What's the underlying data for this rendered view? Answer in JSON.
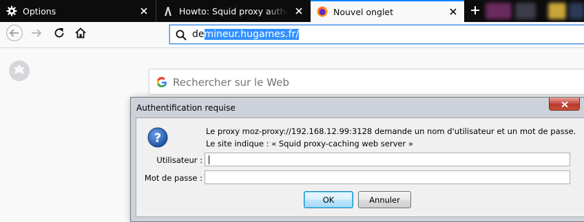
{
  "tabs": [
    {
      "label": "Options",
      "icon": "gear-icon",
      "active": false
    },
    {
      "label": "Howto: Squid proxy authentication",
      "icon": "site-favicon-icon",
      "active": false
    },
    {
      "label": "Nouvel onglet",
      "icon": "firefox-icon",
      "active": true
    }
  ],
  "address_bar": {
    "text_unselected": "de",
    "text_selected": "mineur.hugames.fr/"
  },
  "search_box": {
    "placeholder": "Rechercher sur le Web"
  },
  "dialog": {
    "title": "Authentification requise",
    "message": "Le proxy moz-proxy://192.168.12.99:3128 demande un nom d'utilisateur et un mot de passe. Le site indique : « Squid proxy-caching web server »",
    "username_label": "Utilisateur :",
    "username_value": "",
    "password_label": "Mot de passe :",
    "password_value": "",
    "ok_label": "OK",
    "cancel_label": "Annuler"
  },
  "colors": {
    "tabstrip": "#0c0c0d",
    "accent": "#0a84ff",
    "selection": "#3390ff"
  }
}
